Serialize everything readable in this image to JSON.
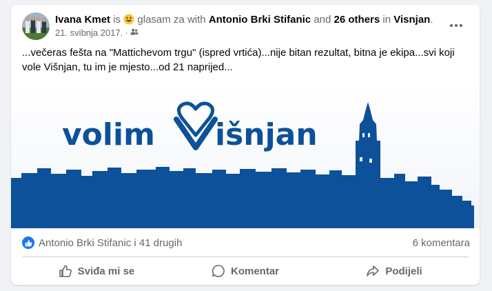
{
  "post": {
    "author": "Ivana Kmet",
    "is_word": "is",
    "feeling": "glasam za",
    "with_word": "with",
    "tagged_person": "Antonio Brki Stifanic",
    "and_word": "and",
    "others": "26 others",
    "in_word": "in",
    "location": "Visnjan",
    "period": ".",
    "date": "21. svibnja 2017.",
    "audience_icon": "friends-icon",
    "text": "...večeras fešta na \"Mattichevom trgu\" (ispred vrtića)...nije bitan rezultat, bitna je ekipa...svi koji vole Višnjan, tu im je mjesto...od 21 naprijed..."
  },
  "image": {
    "text_left": "volim",
    "text_right": "išnjan",
    "brand_color": "#0c5199"
  },
  "reactions": {
    "summary": "Antonio Brki Stifanic i 41 drugih",
    "comments": "6 komentara",
    "reaction_icon": "like-icon"
  },
  "actions": {
    "like": "Sviđa mi se",
    "comment": "Komentar",
    "share": "Podijeli"
  },
  "colors": {
    "accent": "#1877f2",
    "muted_text": "#65676b"
  }
}
